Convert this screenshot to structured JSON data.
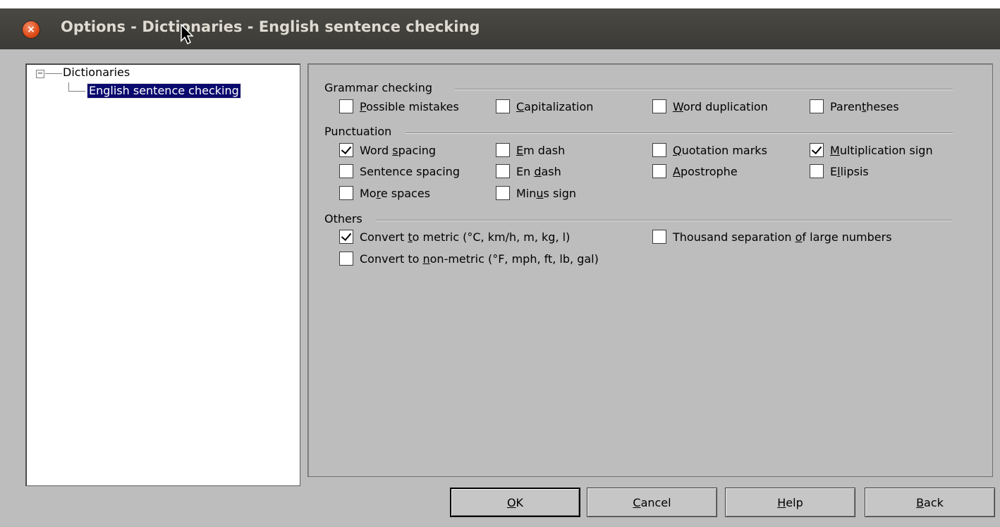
{
  "window": {
    "title": "Options - Dictionaries - English sentence checking"
  },
  "tree": {
    "root": "Dictionaries",
    "child": "English sentence checking",
    "toggle": "−"
  },
  "groups": {
    "grammar": {
      "title": "Grammar checking",
      "options": [
        {
          "pre": "",
          "u": "P",
          "post": "ossible mistakes",
          "checked": false
        },
        {
          "pre": "",
          "u": "C",
          "post": "apitalization",
          "checked": false
        },
        {
          "pre": "",
          "u": "W",
          "post": "ord duplication",
          "checked": false
        },
        {
          "pre": "Paren",
          "u": "t",
          "post": "heses",
          "checked": false
        }
      ]
    },
    "punctuation": {
      "title": "Punctuation",
      "options": [
        {
          "pre": "Word ",
          "u": "s",
          "post": "pacing",
          "checked": true
        },
        {
          "pre": "",
          "u": "E",
          "post": "m dash",
          "checked": false
        },
        {
          "pre": "",
          "u": "Q",
          "post": "uotation marks",
          "checked": false
        },
        {
          "pre": "",
          "u": "M",
          "post": "ultiplication sign",
          "checked": true
        },
        {
          "pre": "Sentence spacin",
          "u": "g",
          "post": "",
          "checked": false
        },
        {
          "pre": "En ",
          "u": "d",
          "post": "ash",
          "checked": false
        },
        {
          "pre": "",
          "u": "A",
          "post": "postrophe",
          "checked": false
        },
        {
          "pre": "E",
          "u": "l",
          "post": "lipsis",
          "checked": false
        },
        {
          "pre": "Mo",
          "u": "r",
          "post": "e spaces",
          "checked": false
        },
        {
          "pre": "Min",
          "u": "u",
          "post": "s sign",
          "checked": false
        }
      ]
    },
    "others": {
      "title": "Others",
      "options": [
        {
          "pre": "Convert ",
          "u": "t",
          "post": "o metric (°C, km/h, m, kg, l)",
          "checked": true
        },
        {
          "pre": "Thousand separation ",
          "u": "o",
          "post": "f large numbers",
          "checked": false
        },
        {
          "pre": "Convert to ",
          "u": "n",
          "post": "on-metric (°F, mph, ft, lb, gal)",
          "checked": false
        }
      ]
    }
  },
  "buttons": {
    "ok": {
      "pre": "",
      "u": "O",
      "post": "K"
    },
    "cancel": {
      "pre": "",
      "u": "C",
      "post": "ancel"
    },
    "help": {
      "pre": "",
      "u": "H",
      "post": "elp"
    },
    "back": {
      "pre": "",
      "u": "B",
      "post": "ack"
    }
  },
  "icons": {
    "close": "close-icon",
    "cursor": "mouse-pointer-icon"
  },
  "colors": {
    "titlebar": "#3c3b37",
    "dialog_bg": "#bdbdbd",
    "selection": "#0a0a6e",
    "close_button": "#df4a16"
  }
}
